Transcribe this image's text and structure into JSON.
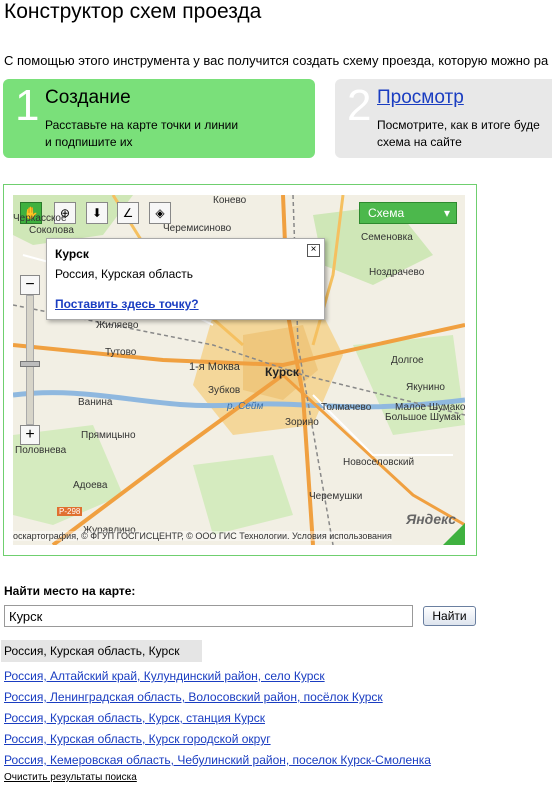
{
  "page": {
    "title": "Конструктор схем проезда",
    "intro": "С помощью этого инструмента у вас получится создать схему проезда, которую можно ра"
  },
  "steps": [
    {
      "number": "1",
      "title": "Создание",
      "desc_line1": "Расставьте на карте точки и линии",
      "desc_line2": "и подпишите их"
    },
    {
      "number": "2",
      "title": "Просмотр",
      "desc_line1": "Посмотрите, как в итоге буде",
      "desc_line2": "схема на сайте"
    }
  ],
  "map": {
    "tools": [
      "hand-icon",
      "zoom-area-icon",
      "point-icon",
      "line-icon",
      "polygon-icon"
    ],
    "layer_button": "Схема",
    "popup": {
      "title": "Курск",
      "subtitle": "Россия, Курская область",
      "link": "Поставить здесь точку?"
    },
    "labels": {
      "konevo": "Конево",
      "cheremisinovo": "Черемисиново",
      "cherkasnoe": "Черкасское",
      "sokolova": "Соколова",
      "semenovka": "Семеновка",
      "nozdrachevo": "Ноздрачево",
      "zhilyaevo": "Жиляево",
      "mokva": "1-я Моква",
      "kursk": "Курск",
      "doltoe": "Долгое",
      "tutovo": "Тутово",
      "zubkov": "Зубков",
      "yakunino": "Якунино",
      "vanina": "Ванина",
      "tolmachevo": "Толмачево",
      "maloe_shumakovo": "Малое Шумаков",
      "bolshoe_shumakovo": "Большое Шумак",
      "zorino": "Зорино",
      "pryamitsyno": "Прямицыно",
      "polovneva": "Половнева",
      "novoselovsky": "Новоселовский",
      "adoeva": "Адоева",
      "cheremushki": "Черемушки",
      "zhuravlino": "Журавлино",
      "river": "р. Сейм",
      "road": "Р-298"
    },
    "copyright": "оскартография, © ФГУП ГОСГИСЦЕНТР, © ООО ГИС Технологии. Условия использования",
    "logo": "Яндекс"
  },
  "search": {
    "label": "Найти место на карте:",
    "value": "Курск",
    "button": "Найти"
  },
  "results": {
    "selected": "Россия, Курская область, Курск",
    "items": [
      "Россия, Алтайский край, Кулундинский район, село Курск",
      "Россия, Ленинградская область, Волосовский район, посёлок Курск",
      "Россия, Курская область, Курск, станция Курск",
      "Россия, Курская область, Курск городской округ",
      "Россия, Кемеровская область, Чебулинский район, поселок Курск-Смоленка"
    ],
    "clear": "Очистить результаты поиска"
  },
  "colors": {
    "step_active": "#7ae07a",
    "step_inactive": "#e8e8e8",
    "link": "#1a3dc1",
    "map_frame": "#6fcf6f",
    "map_bg": "#f2efe4"
  }
}
